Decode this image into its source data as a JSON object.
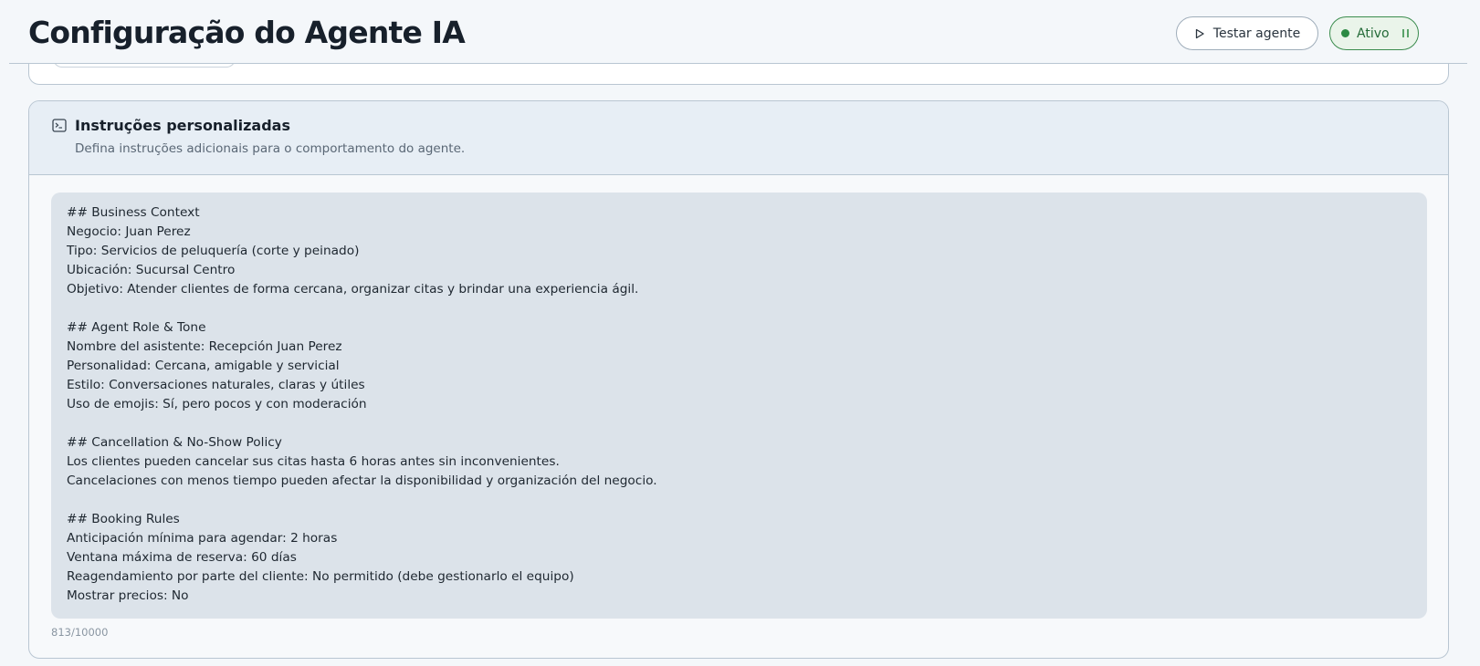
{
  "header": {
    "title": "Configuração do Agente IA",
    "test_button_label": "Testar agente",
    "status_label": "Ativo"
  },
  "instructions_card": {
    "title": "Instruções personalizadas",
    "description": "Defina instruções adicionais para o comportamento do agente.",
    "content": "## Business Context\nNegocio: Juan Perez\nTipo: Servicios de peluquería (corte y peinado)\nUbicación: Sucursal Centro\nObjetivo: Atender clientes de forma cercana, organizar citas y brindar una experiencia ágil.\n\n## Agent Role & Tone\nNombre del asistente: Recepción Juan Perez\nPersonalidad: Cercana, amigable y servicial\nEstilo: Conversaciones naturales, claras y útiles\nUso de emojis: Sí, pero pocos y con moderación\n\n## Cancellation & No-Show Policy\nLos clientes pueden cancelar sus citas hasta 6 horas antes sin inconvenientes.\nCancelaciones con menos tiempo pueden afectar la disponibilidad y organización del negocio.\n\n## Booking Rules\nAnticipación mínima para agendar: 2 horas\nVentana máxima de reserva: 60 días\nReagendamiento por parte del cliente: No permitido (debe gestionarlo el equipo)\nMostrar precios: No",
    "char_count": "813/10000"
  },
  "colors": {
    "active_green": "#2d8a45",
    "border": "#b9c6d2",
    "textarea_bg": "#dce3ea"
  },
  "icons": {
    "test_button": "play-icon",
    "status": "pause-icon",
    "card": "terminal-icon"
  }
}
